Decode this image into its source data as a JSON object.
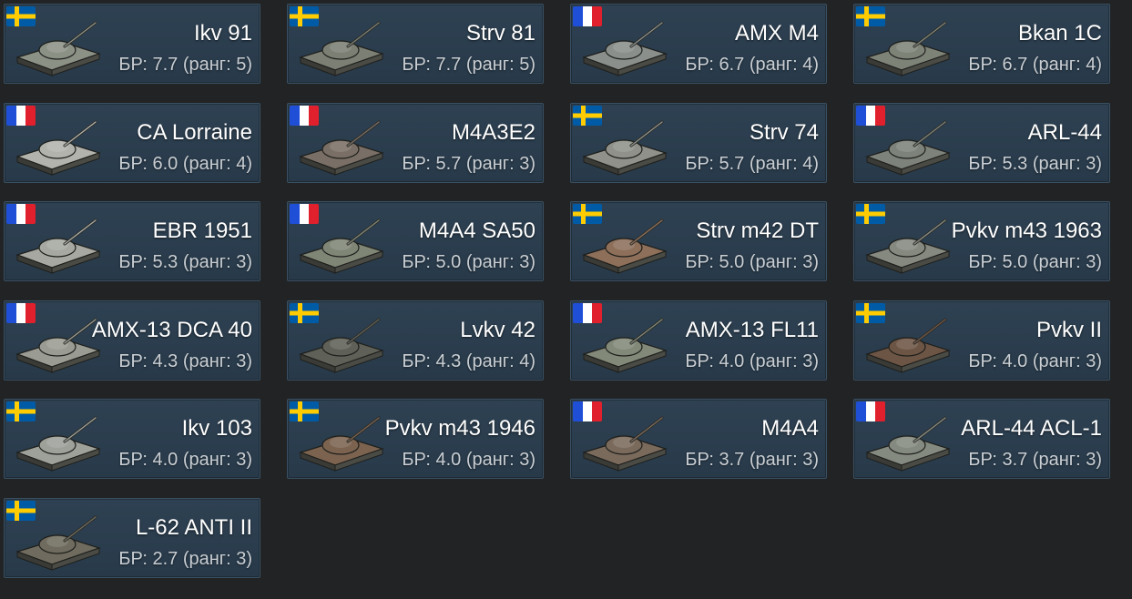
{
  "colors": {
    "background": "#222324",
    "card": "#2e4152",
    "card_border": "#3a5062",
    "name_text": "#ffffff",
    "br_text": "#c9ced3",
    "sweden_blue": "#005ba7",
    "sweden_yellow": "#fecc00",
    "france_blue": "#1f4fd6",
    "france_white": "#ffffff",
    "france_red": "#e0202c"
  },
  "vehicles": [
    {
      "name": "Ikv 91",
      "br_text": "БР: 7.7 (ранг: 5)",
      "nation": "sweden",
      "camo": "#8c9186"
    },
    {
      "name": "Strv 81",
      "br_text": "БР: 7.7 (ранг: 5)",
      "nation": "sweden",
      "camo": "#7c7f73"
    },
    {
      "name": "AMX M4",
      "br_text": "БР: 6.7 (ранг: 4)",
      "nation": "france",
      "camo": "#8a8f8b"
    },
    {
      "name": "Bkan 1C",
      "br_text": "БР: 6.7 (ранг: 4)",
      "nation": "sweden",
      "camo": "#7e8378"
    },
    {
      "name": "CA Lorraine",
      "br_text": "БР: 6.0 (ранг: 4)",
      "nation": "france",
      "camo": "#b2b3ad"
    },
    {
      "name": "M4A3E2",
      "br_text": "БР: 5.7 (ранг: 3)",
      "nation": "france",
      "camo": "#7a6f66"
    },
    {
      "name": "Strv 74",
      "br_text": "БР: 5.7 (ранг: 4)",
      "nation": "sweden",
      "camo": "#8f918a"
    },
    {
      "name": "ARL-44",
      "br_text": "БР: 5.3 (ранг: 3)",
      "nation": "france",
      "camo": "#7d827a"
    },
    {
      "name": "EBR 1951",
      "br_text": "БР: 5.3 (ранг: 3)",
      "nation": "france",
      "camo": "#a6a8a1"
    },
    {
      "name": "M4A4 SA50",
      "br_text": "БР: 5.0 (ранг: 3)",
      "nation": "france",
      "camo": "#7f8676"
    },
    {
      "name": "Strv m42 DT",
      "br_text": "БР: 5.0 (ранг: 3)",
      "nation": "sweden",
      "camo": "#8d6f5a"
    },
    {
      "name": "Pvkv m43 1963",
      "br_text": "БР: 5.0 (ранг: 3)",
      "nation": "sweden",
      "camo": "#868980"
    },
    {
      "name": "AMX-13 DCA 40",
      "br_text": "БР: 4.3 (ранг: 3)",
      "nation": "france",
      "camo": "#9a9c93"
    },
    {
      "name": "Lvkv 42",
      "br_text": "БР: 4.3 (ранг: 4)",
      "nation": "sweden",
      "camo": "#5f6158"
    },
    {
      "name": "AMX-13 FL11",
      "br_text": "БР: 4.0 (ранг: 3)",
      "nation": "france",
      "camo": "#828979"
    },
    {
      "name": "Pvkv II",
      "br_text": "БР: 4.0 (ранг: 3)",
      "nation": "sweden",
      "camo": "#6d5545"
    },
    {
      "name": "Ikv 103",
      "br_text": "БР: 4.0 (ранг: 3)",
      "nation": "sweden",
      "camo": "#9ea19a"
    },
    {
      "name": "Pvkv m43 1946",
      "br_text": "БР: 4.0 (ранг: 3)",
      "nation": "sweden",
      "camo": "#7b6350"
    },
    {
      "name": "M4A4",
      "br_text": "БР: 3.7 (ранг: 3)",
      "nation": "france",
      "camo": "#7a6a5c"
    },
    {
      "name": "ARL-44 ACL-1",
      "br_text": "БР: 3.7 (ранг: 3)",
      "nation": "france",
      "camo": "#858a80"
    },
    {
      "name": "L-62 ANTI II",
      "br_text": "БР: 2.7 (ранг: 3)",
      "nation": "sweden",
      "camo": "#6f6b5e"
    }
  ]
}
